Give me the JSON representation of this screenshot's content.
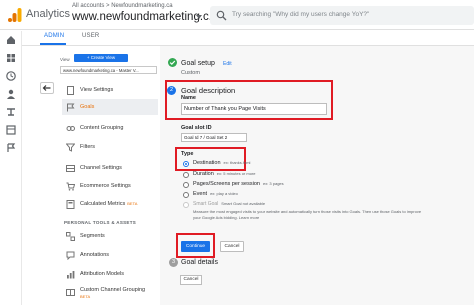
{
  "header": {
    "app_name": "Analytics",
    "account_crumb": "All accounts > Newfoundmarketing.ca",
    "account_name": "www.newfoundmarketing.c...",
    "search_placeholder": "Try searching \"Why did my users change YoY?\""
  },
  "tabs": [
    {
      "label": "ADMIN",
      "active": true
    },
    {
      "label": "USER",
      "active": false
    }
  ],
  "admin_nav": {
    "view_label": "View",
    "create_view_label": "+ Create View",
    "view_selected": "www.newfoundmarketing.ca - Master V...",
    "items": [
      {
        "label": "View Settings",
        "icon": "page-icon",
        "active": false
      },
      {
        "label": "Goals",
        "icon": "flag-icon",
        "active": true
      },
      {
        "label": "Content Grouping",
        "icon": "content-grouping-icon",
        "active": false
      },
      {
        "label": "Filters",
        "icon": "filter-icon",
        "active": false
      },
      {
        "label": "Channel Settings",
        "icon": "channel-icon",
        "active": false
      },
      {
        "label": "Ecommerce Settings",
        "icon": "cart-icon",
        "active": false
      },
      {
        "label": "Calculated Metrics",
        "icon": "calculator-icon",
        "active": false,
        "badge": "BETA"
      }
    ],
    "section_header": "PERSONAL TOOLS & ASSETS",
    "personal_items": [
      {
        "label": "Segments",
        "icon": "segments-icon"
      },
      {
        "label": "Annotations",
        "icon": "annotation-icon"
      },
      {
        "label": "Attribution Models",
        "icon": "attribution-icon"
      },
      {
        "label": "Custom Channel Grouping",
        "icon": "channel-group-icon",
        "badge": "BETA"
      }
    ]
  },
  "goal_setup": {
    "title": "Goal setup",
    "edit_label": "Edit",
    "subtitle": "Custom"
  },
  "goal_description": {
    "step_number": "2",
    "title": "Goal description",
    "name_label": "Name",
    "name_value": "Number of Thank you Page Visits",
    "slot_label": "Goal slot ID",
    "slot_value": "Goal Id 7 / Goal Set 2",
    "type_label": "Type",
    "types": [
      {
        "label": "Destination",
        "example": "ex: thanks.html",
        "checked": true
      },
      {
        "label": "Duration",
        "example": "ex: 5 minutes or more",
        "checked": false
      },
      {
        "label": "Pages/Screens per session",
        "example": "ex: 3 pages",
        "checked": false
      },
      {
        "label": "Event",
        "example": "ex: play a video",
        "checked": false
      }
    ],
    "smart_goal": {
      "label": "Smart Goal",
      "note": "Smart Goal not available",
      "desc1": "Measure the most engaged visits to your website and automatically turn those visits into Goals. Then use those Goals to improve",
      "desc2": "your Google Ads bidding. Learn more"
    },
    "continue_label": "Continue",
    "cancel_label": "Cancel"
  },
  "goal_details": {
    "step_number": "3",
    "title": "Goal details"
  },
  "footer_cancel": "Cancel"
}
